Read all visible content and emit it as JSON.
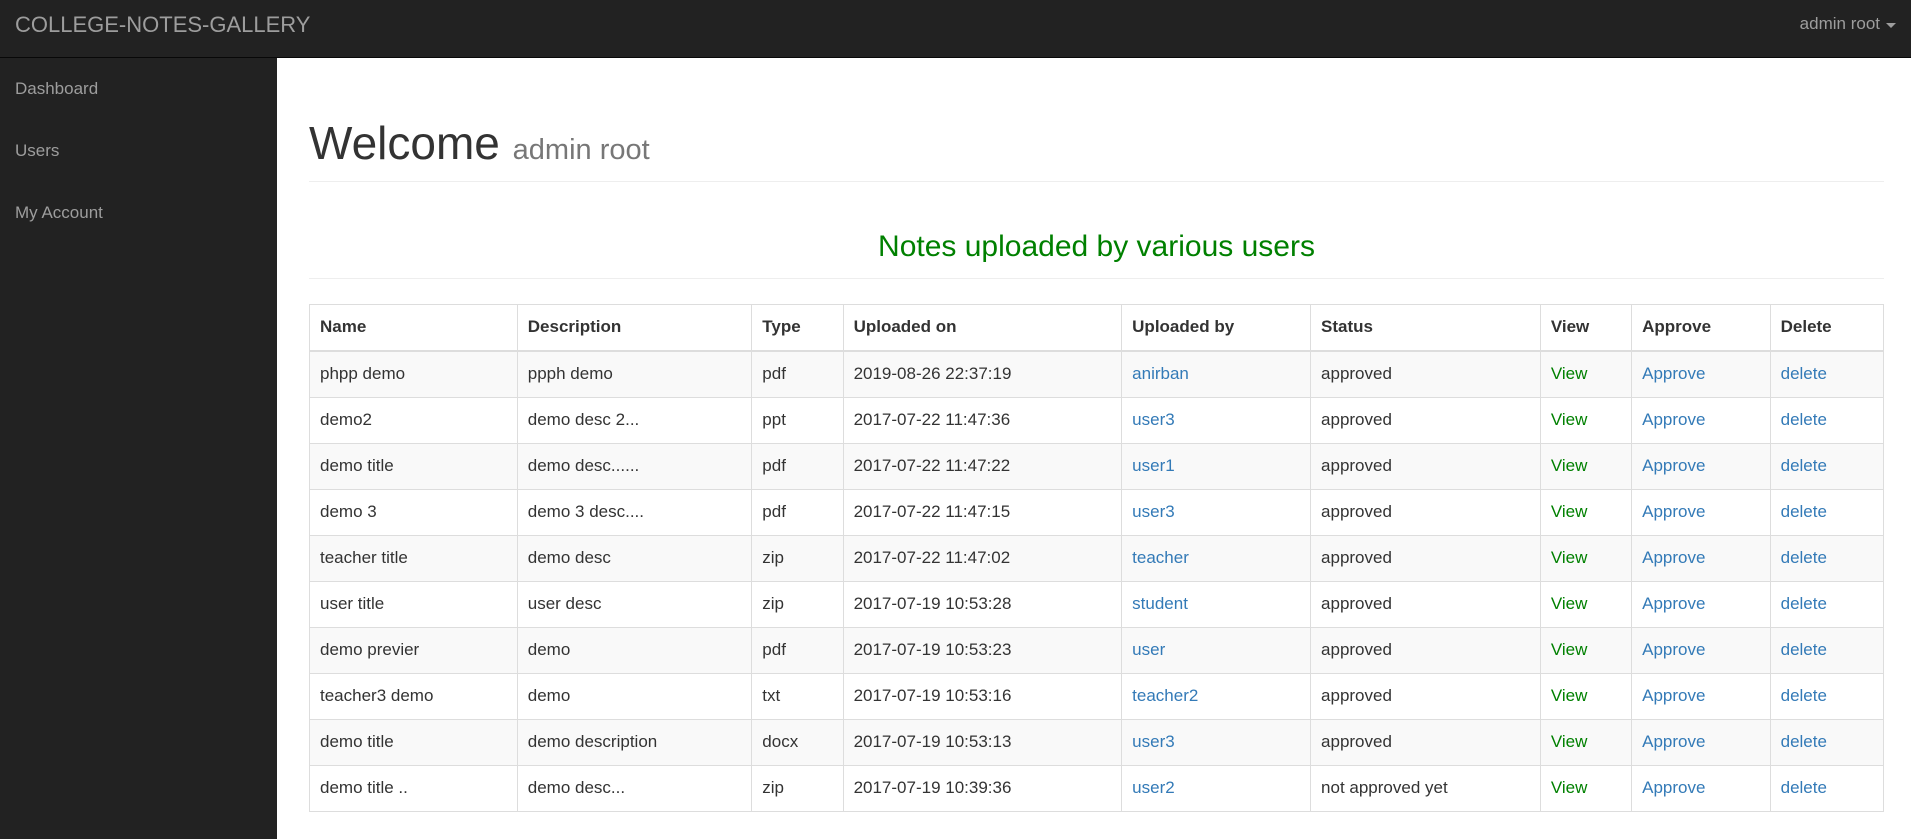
{
  "navbar": {
    "brand": "COLLEGE-NOTES-GALLERY",
    "user_menu_label": "admin root",
    "user_menu_icon": "caret-down-icon"
  },
  "sidebar": {
    "items": [
      {
        "label": "Dashboard"
      },
      {
        "label": "Users"
      },
      {
        "label": "My Account"
      }
    ]
  },
  "header": {
    "title": "Welcome",
    "subtitle": "admin root"
  },
  "section": {
    "title": "Notes uploaded by various users",
    "title_color": "#008000"
  },
  "table": {
    "columns": [
      "Name",
      "Description",
      "Type",
      "Uploaded on",
      "Uploaded by",
      "Status",
      "View",
      "Approve",
      "Delete"
    ],
    "rows": [
      {
        "name": "phpp demo",
        "description": "ppph demo",
        "type": "pdf",
        "uploaded_on": "2019-08-26 22:37:19",
        "uploaded_by": "anirban",
        "status": "approved",
        "view": "View",
        "approve": "Approve",
        "delete": "delete"
      },
      {
        "name": "demo2",
        "description": "demo desc 2...",
        "type": "ppt",
        "uploaded_on": "2017-07-22 11:47:36",
        "uploaded_by": "user3",
        "status": "approved",
        "view": "View",
        "approve": "Approve",
        "delete": "delete"
      },
      {
        "name": "demo title",
        "description": "demo desc......",
        "type": "pdf",
        "uploaded_on": "2017-07-22 11:47:22",
        "uploaded_by": "user1",
        "status": "approved",
        "view": "View",
        "approve": "Approve",
        "delete": "delete"
      },
      {
        "name": "demo 3",
        "description": "demo 3 desc....",
        "type": "pdf",
        "uploaded_on": "2017-07-22 11:47:15",
        "uploaded_by": "user3",
        "status": "approved",
        "view": "View",
        "approve": "Approve",
        "delete": "delete"
      },
      {
        "name": "teacher title",
        "description": "demo desc",
        "type": "zip",
        "uploaded_on": "2017-07-22 11:47:02",
        "uploaded_by": "teacher",
        "status": "approved",
        "view": "View",
        "approve": "Approve",
        "delete": "delete"
      },
      {
        "name": "user title",
        "description": "user desc",
        "type": "zip",
        "uploaded_on": "2017-07-19 10:53:28",
        "uploaded_by": "student",
        "status": "approved",
        "view": "View",
        "approve": "Approve",
        "delete": "delete"
      },
      {
        "name": "demo previer",
        "description": "demo",
        "type": "pdf",
        "uploaded_on": "2017-07-19 10:53:23",
        "uploaded_by": "user",
        "status": "approved",
        "view": "View",
        "approve": "Approve",
        "delete": "delete"
      },
      {
        "name": "teacher3 demo",
        "description": "demo",
        "type": "txt",
        "uploaded_on": "2017-07-19 10:53:16",
        "uploaded_by": "teacher2",
        "status": "approved",
        "view": "View",
        "approve": "Approve",
        "delete": "delete"
      },
      {
        "name": "demo title",
        "description": "demo description",
        "type": "docx",
        "uploaded_on": "2017-07-19 10:53:13",
        "uploaded_by": "user3",
        "status": "approved",
        "view": "View",
        "approve": "Approve",
        "delete": "delete"
      },
      {
        "name": "demo title ..",
        "description": "demo desc...",
        "type": "zip",
        "uploaded_on": "2017-07-19 10:39:36",
        "uploaded_by": "user2",
        "status": "not approved yet",
        "view": "View",
        "approve": "Approve",
        "delete": "delete"
      }
    ]
  },
  "colors": {
    "navbar_bg": "#222222",
    "link": "#337ab7",
    "view_link": "#008000"
  }
}
